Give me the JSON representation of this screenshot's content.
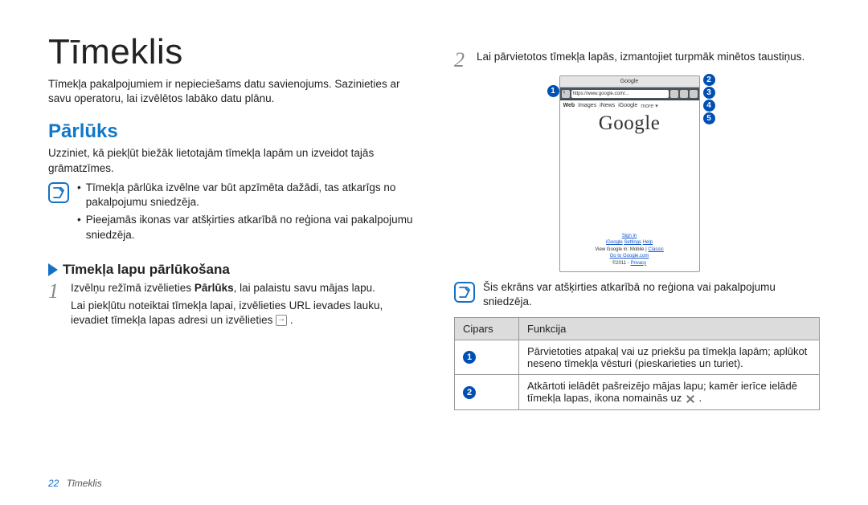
{
  "title": "Tīmeklis",
  "intro": "Tīmekļa pakalpojumiem ir nepieciešams datu savienojums. Sazinieties ar savu operatoru, lai izvēlētos labāko datu plānu.",
  "section1": {
    "heading": "Pārlūks",
    "lead": "Uzziniet, kā piekļūt biežāk lietotajām tīmekļa lapām un izveidot tajās grāmatzīmes.",
    "notes": [
      "Tīmekļa pārlūka izvēlne var būt apzīmēta dažādi, tas atkarīgs no pakalpojumu sniedzēja.",
      "Pieejamās ikonas var atšķirties atkarībā no reģiona vai pakalpojumu sniedzēja."
    ]
  },
  "subsection": {
    "heading": "Tīmekļa lapu pārlūkošana",
    "step1_a": "Izvēlņu režīmā izvēlieties ",
    "step1_b": "Pārlūks",
    "step1_c": ", lai palaistu savu mājas lapu.",
    "step1_cont": "Lai piekļūtu noteiktai tīmekļa lapai, izvēlieties URL ievades lauku, ievadiet tīmekļa lapas adresi un izvēlieties "
  },
  "right": {
    "step2_num": "2",
    "step2": "Lai pārvietotos tīmekļa lapās, izmantojiet turpmāk minētos taustiņus.",
    "shot": {
      "topbar": "Google",
      "url": "https://www.google.com/...",
      "menu": {
        "web": "Web",
        "images": "Images",
        "news": "iNews",
        "igoogle": "iGoogle",
        "more": "more ▾"
      },
      "logo": "Google",
      "footer": {
        "signin": "Sign in",
        "row2a": "iGoogle",
        "row2b": "Settings",
        "row2c": "Help",
        "row3a": "View Google in:",
        "row3b": "Mobile",
        "row3c": "Classic",
        "row4": "Go to Google.com",
        "row5a": "©2011 -",
        "row5b": "Privacy"
      }
    },
    "callouts": [
      "1",
      "2",
      "3",
      "4",
      "5"
    ],
    "note": "Šis ekrāns var atšķirties atkarībā no reģiona vai pakalpojumu sniedzēja.",
    "table": {
      "headers": {
        "num": "Cipars",
        "func": "Funkcija"
      },
      "rows": [
        {
          "n": "1",
          "t": "Pārvietoties atpakaļ vai uz priekšu pa tīmekļa lapām; aplūkot neseno tīmekļa vēsturi (pieskarieties un turiet)."
        },
        {
          "n": "2",
          "t": "Atkārtoti ielādēt pašreizējo mājas lapu; kamēr ierīce ielādē tīmekļa lapas, ikona nomainās uz "
        }
      ]
    }
  },
  "footer": {
    "page": "22",
    "section": "Tīmeklis"
  }
}
